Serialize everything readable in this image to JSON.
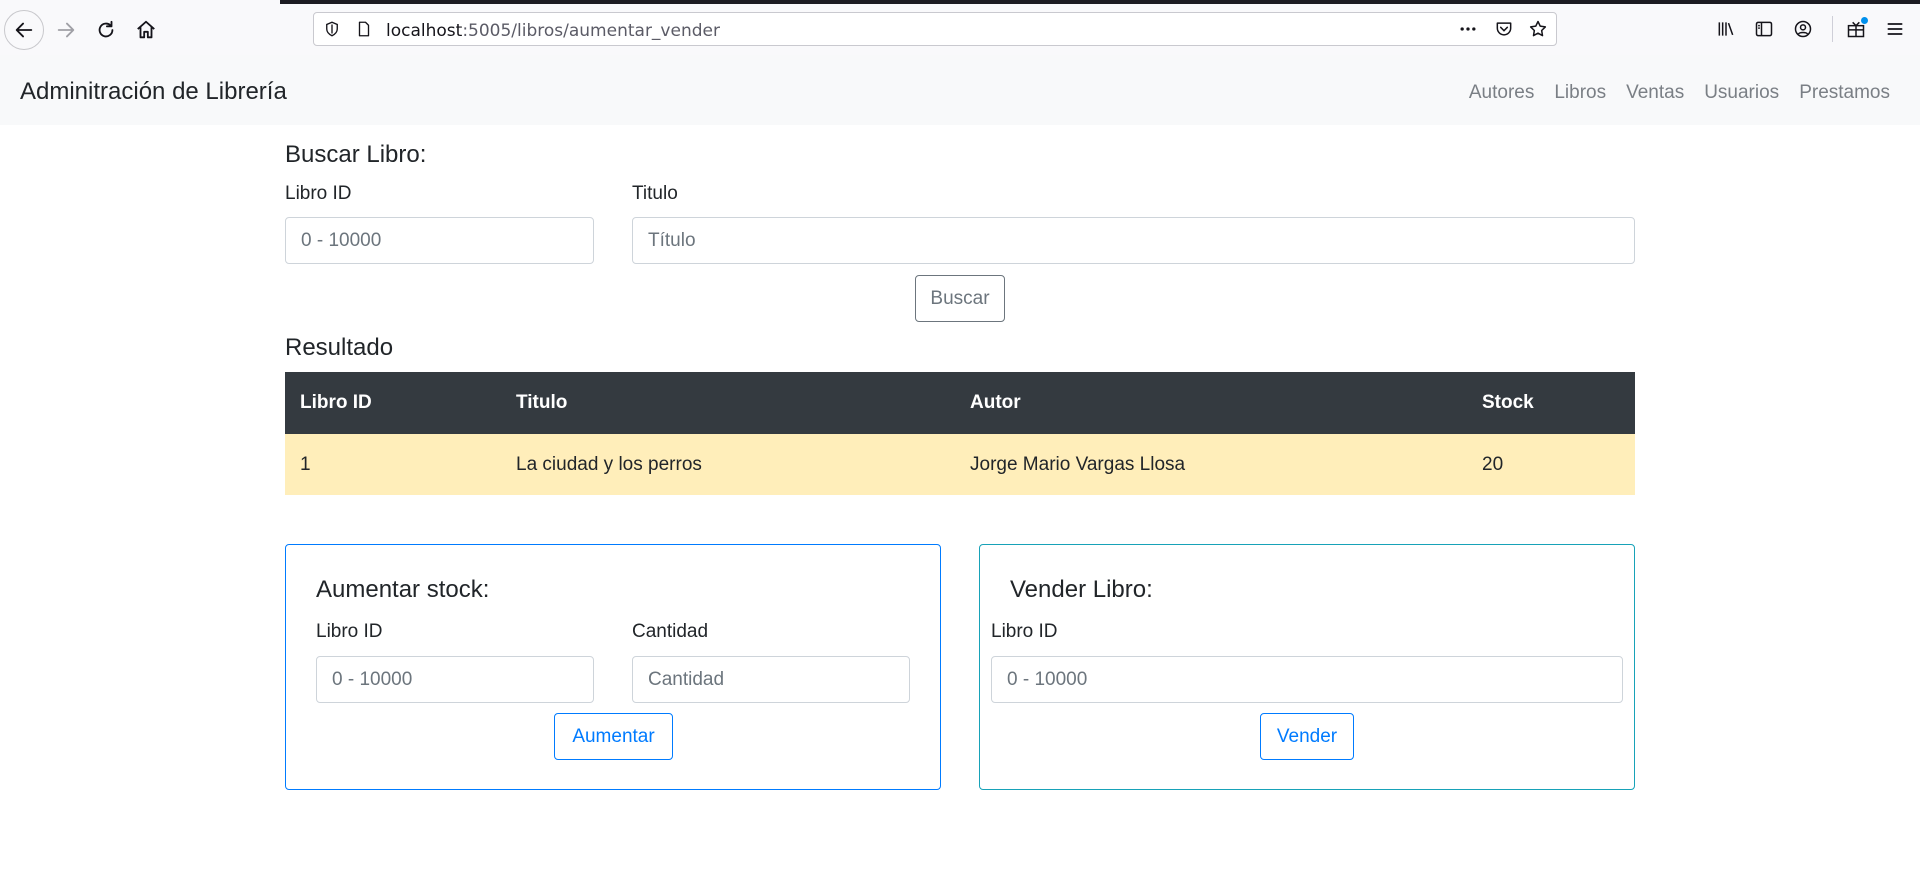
{
  "browser": {
    "url_host": "localhost",
    "url_path": ":5005/libros/aumentar_vender"
  },
  "navbar": {
    "brand": "Adminitración de Librería",
    "links": [
      "Autores",
      "Libros",
      "Ventas",
      "Usuarios",
      "Prestamos"
    ]
  },
  "search": {
    "title": "Buscar Libro:",
    "id_label": "Libro ID",
    "id_placeholder": "0 - 10000",
    "title_label": "Titulo",
    "title_placeholder": "Título",
    "button": "Buscar"
  },
  "results": {
    "title": "Resultado",
    "columns": [
      "Libro ID",
      "Titulo",
      "Autor",
      "Stock"
    ],
    "rows": [
      [
        "1",
        "La ciudad y los perros",
        "Jorge Mario Vargas Llosa",
        "20"
      ]
    ]
  },
  "increase_stock": {
    "title": "Aumentar stock:",
    "id_label": "Libro ID",
    "id_placeholder": "0 - 10000",
    "qty_label": "Cantidad",
    "qty_placeholder": "Cantidad",
    "button": "Aumentar"
  },
  "sell_book": {
    "title": "Vender Libro:",
    "id_label": "Libro ID",
    "id_placeholder": "0 - 10000",
    "button": "Vender"
  },
  "colors": {
    "primary": "#007bff",
    "info": "#17a2b8",
    "secondary": "#6c757d",
    "table_header": "#343a40",
    "row_warning": "#ffeeba"
  }
}
